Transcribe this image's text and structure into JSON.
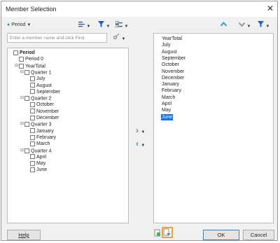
{
  "dialog": {
    "title": "Member Selection",
    "close_symbol": "✕"
  },
  "toolbar_left": {
    "dimension_label": "Period",
    "dimension_bullet": "●",
    "caret": "▼",
    "funnel_symbol": "▼"
  },
  "toolbar_right": {
    "up_symbol": "⌃",
    "down_symbol": "⌄",
    "caret": "▼",
    "funnel_symbol": "▼"
  },
  "search": {
    "placeholder": "Enter a member name and click Find.",
    "value": "",
    "find_symbol": "✂"
  },
  "tree": {
    "nodes": [
      {
        "label": "Period",
        "depth": 0,
        "toggle": "",
        "bold": true
      },
      {
        "label": "Period 0",
        "depth": 1,
        "toggle": ""
      },
      {
        "label": "YearTotal",
        "depth": 1,
        "toggle": "⊟"
      },
      {
        "label": "Quarter 1",
        "depth": 2,
        "toggle": "⊟"
      },
      {
        "label": "July",
        "depth": 3,
        "toggle": ""
      },
      {
        "label": "August",
        "depth": 3,
        "toggle": ""
      },
      {
        "label": "September",
        "depth": 3,
        "toggle": ""
      },
      {
        "label": "Quarter 2",
        "depth": 2,
        "toggle": "⊟"
      },
      {
        "label": "October",
        "depth": 3,
        "toggle": ""
      },
      {
        "label": "November",
        "depth": 3,
        "toggle": ""
      },
      {
        "label": "December",
        "depth": 3,
        "toggle": ""
      },
      {
        "label": "Quarter 3",
        "depth": 2,
        "toggle": "⊟"
      },
      {
        "label": "January",
        "depth": 3,
        "toggle": ""
      },
      {
        "label": "February",
        "depth": 3,
        "toggle": ""
      },
      {
        "label": "March",
        "depth": 3,
        "toggle": ""
      },
      {
        "label": "Quarter 4",
        "depth": 2,
        "toggle": "⊟"
      },
      {
        "label": "April",
        "depth": 3,
        "toggle": ""
      },
      {
        "label": "May",
        "depth": 3,
        "toggle": ""
      },
      {
        "label": "June",
        "depth": 3,
        "toggle": ""
      }
    ]
  },
  "move": {
    "add_symbol": "›",
    "remove_symbol": "‹",
    "caret": "▼"
  },
  "selection": {
    "items": [
      "YearTotal",
      "July",
      "August",
      "September",
      "October",
      "November",
      "December",
      "January",
      "February",
      "March",
      "April",
      "May",
      "June"
    ],
    "selected_item": "June"
  },
  "footer": {
    "help_label": "Help",
    "ok_label": "OK",
    "cancel_label": "Cancel"
  },
  "colors": {
    "accent_blue": "#1565c0",
    "accent_teal": "#2aa3c5",
    "selection_blue": "#1e6fd9",
    "highlight_orange": "#f0a040"
  }
}
